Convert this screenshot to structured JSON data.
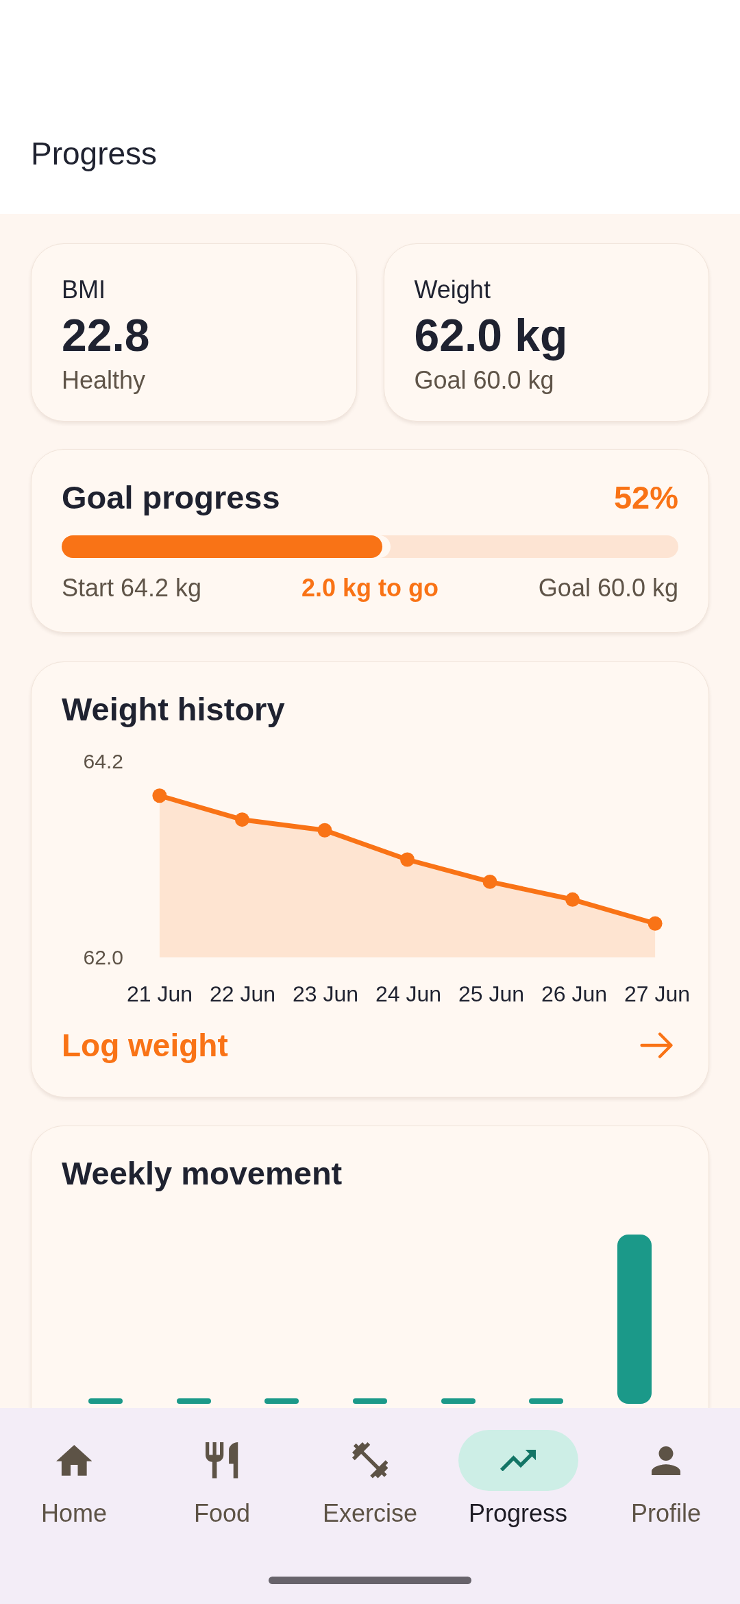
{
  "header": {
    "title": "Progress"
  },
  "stats": [
    {
      "label": "BMI",
      "value": "22.8",
      "note": "Healthy"
    },
    {
      "label": "Weight",
      "value": "62.0 kg",
      "note": "Goal 60.0 kg"
    }
  ],
  "goal_progress": {
    "title": "Goal progress",
    "percent": "52%",
    "level": 0.52,
    "start": "Start 64.2 kg",
    "remaining": "2.0 kg to go",
    "goal": "Goal 60.0 kg"
  },
  "weight_history": {
    "title": "Weight history",
    "chart_data": {
      "type": "area",
      "categories": [
        "21 Jun",
        "22 Jun",
        "23 Jun",
        "24 Jun",
        "25 Jun",
        "26 Jun",
        "27 Jun"
      ],
      "series": [
        {
          "color": "#f97316",
          "values": [
            63.82,
            63.55,
            63.43,
            63.1,
            62.85,
            62.65,
            62.38
          ]
        }
      ],
      "ylim": [
        62.0,
        64.2
      ],
      "yticks": [
        {
          "value": 62.0,
          "label": "62.0"
        },
        {
          "value": 64.2,
          "label": "64.2"
        }
      ]
    },
    "action": "Log weight"
  },
  "weekly_movement": {
    "title": "Weekly movement"
  },
  "nav": [
    {
      "label": "Home",
      "selected": false
    },
    {
      "label": "Food",
      "selected": false
    },
    {
      "label": "Exercise",
      "selected": false
    },
    {
      "label": "Progress",
      "selected": true
    },
    {
      "label": "Profile",
      "selected": false
    }
  ]
}
